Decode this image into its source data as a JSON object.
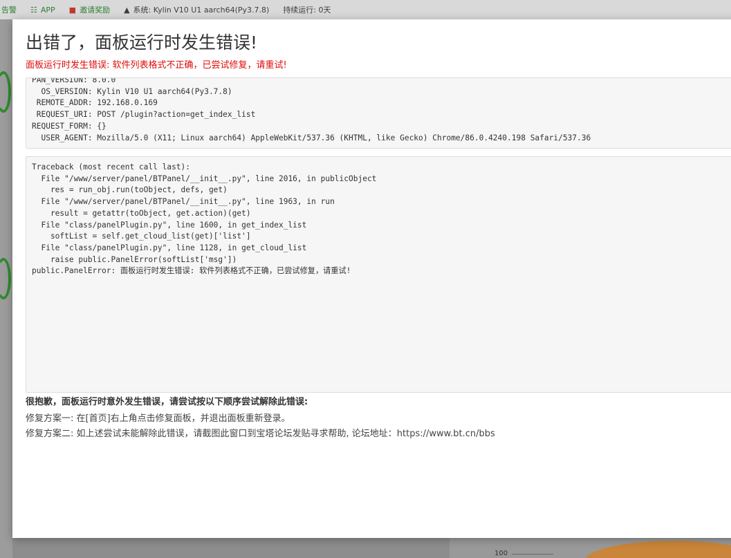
{
  "background": {
    "topbar": {
      "notice": "告警",
      "app": "APP",
      "invite": "邀请奖励",
      "system": "系统:  Kylin V10 U1 aarch64(Py3.7.8)",
      "uptime": "持续运行: 0天"
    },
    "chart_tick": "100"
  },
  "dialog": {
    "title": "出错了，面板运行时发生错误!",
    "subtitle": "面板运行时发生错误: 软件列表格式不正确，已尝试修复，请重试!",
    "env": [
      "PAN_VERSION: 8.0.0",
      "  OS_VERSION: Kylin V10 U1 aarch64(Py3.7.8)",
      " REMOTE_ADDR: 192.168.0.169",
      " REQUEST_URI: POST /plugin?action=get_index_list",
      "REQUEST_FORM: {}",
      "  USER_AGENT: Mozilla/5.0 (X11; Linux aarch64) AppleWebKit/537.36 (KHTML, like Gecko) Chrome/86.0.4240.198 Safari/537.36"
    ],
    "traceback": [
      "Traceback (most recent call last):",
      "  File \"/www/server/panel/BTPanel/__init__.py\", line 2016, in publicObject",
      "    res = run_obj.run(toObject, defs, get)",
      "  File \"/www/server/panel/BTPanel/__init__.py\", line 1963, in run",
      "    result = getattr(toObject, get.action)(get)",
      "  File \"class/panelPlugin.py\", line 1600, in get_index_list",
      "    softList = self.get_cloud_list(get)['list']",
      "  File \"class/panelPlugin.py\", line 1128, in get_cloud_list",
      "    raise public.PanelError(softList['msg'])",
      "public.PanelError: 面板运行时发生错误: 软件列表格式不正确，已尝试修复，请重试!"
    ],
    "help_title": "很抱歉，面板运行时意外发生错误，请尝试按以下顺序尝试解除此错误:",
    "help_lines": [
      "修复方案一: 在[首页]右上角点击修复面板，并退出面板重新登录。",
      "修复方案二: 如上述尝试未能解除此错误，请截图此窗口到宝塔论坛发贴寻求帮助, 论坛地址：https://www.bt.cn/bbs"
    ]
  }
}
